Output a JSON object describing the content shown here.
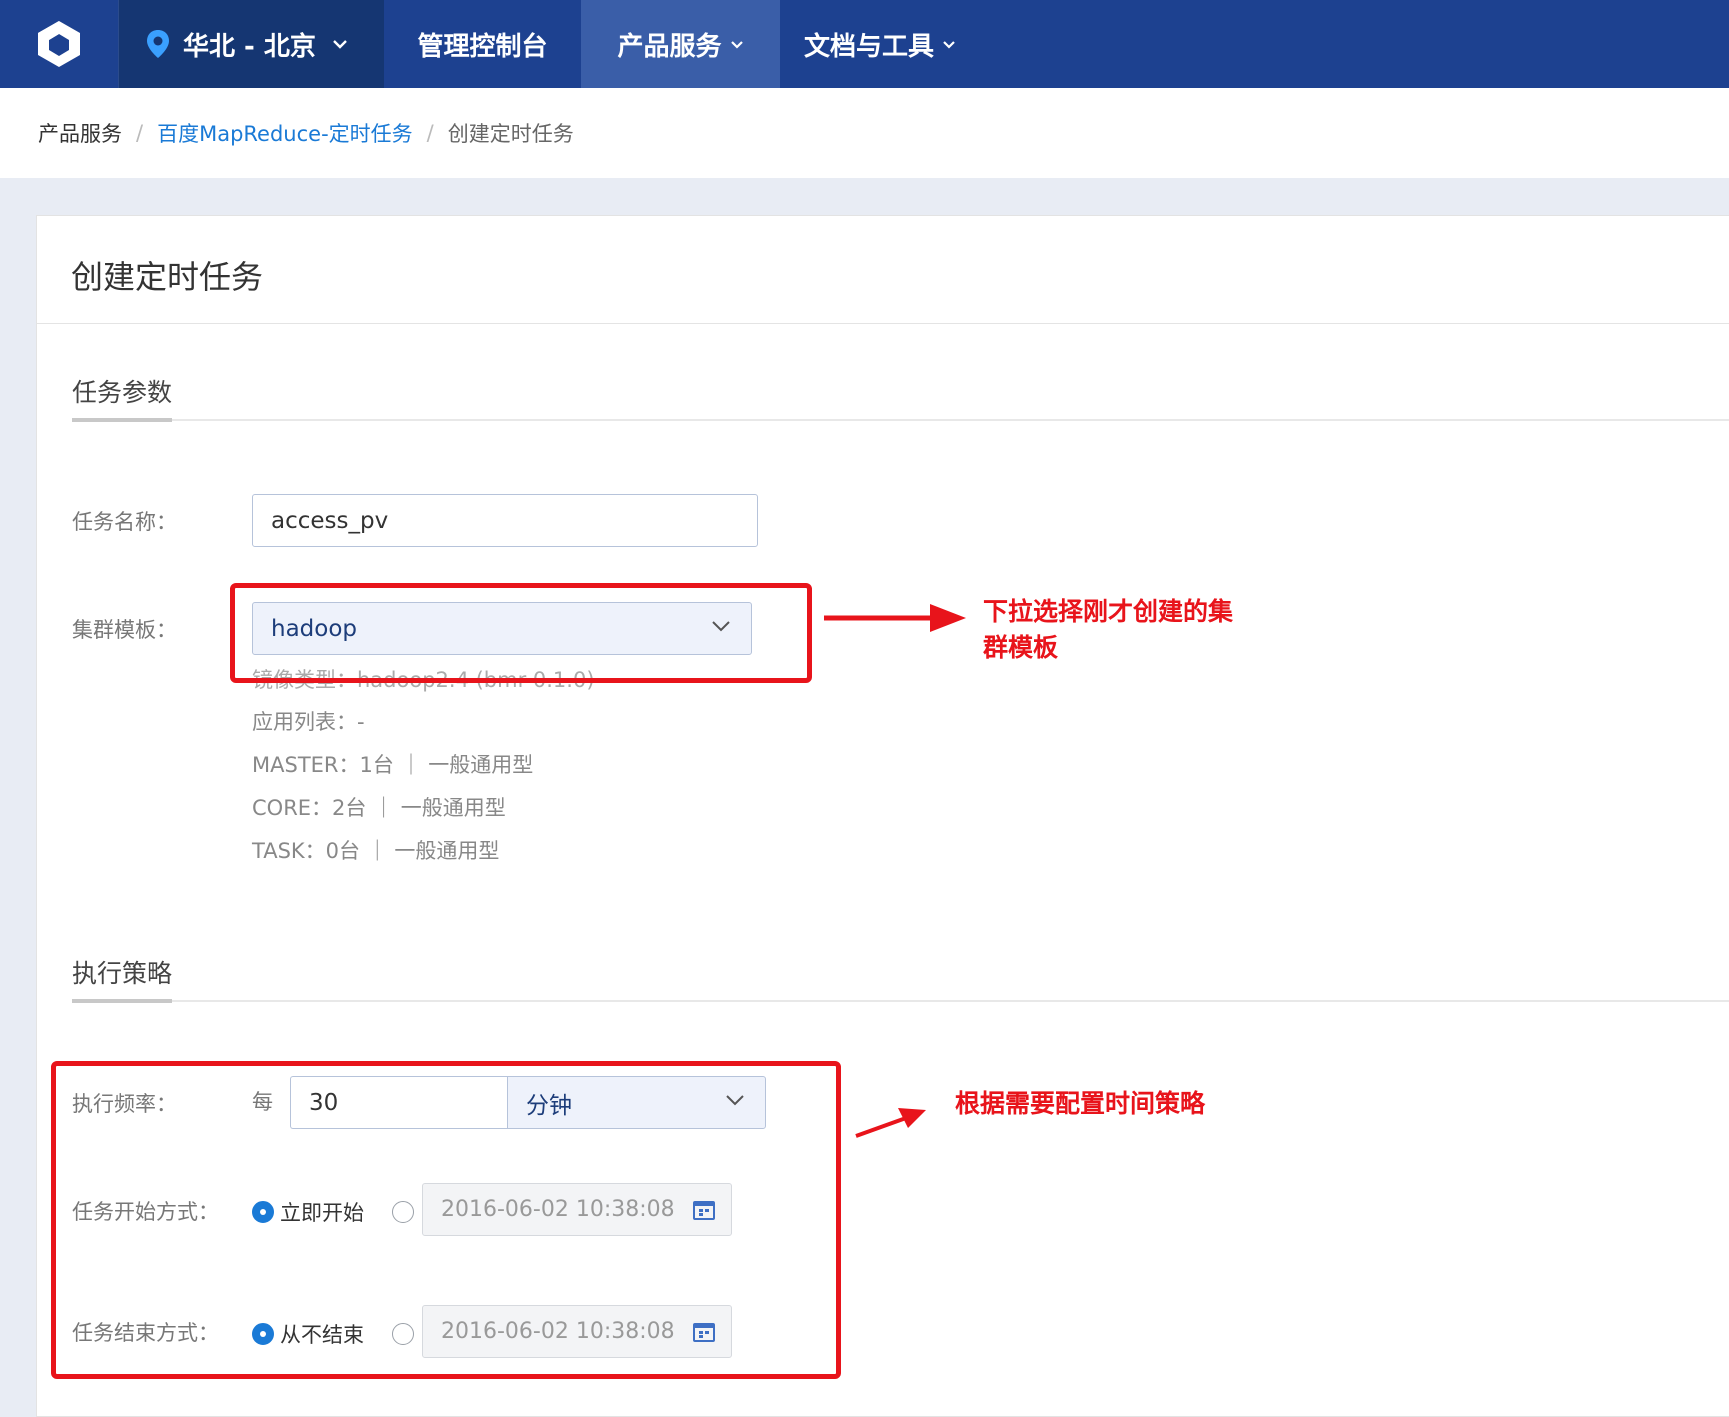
{
  "nav": {
    "region": "华北 - 北京",
    "items": [
      {
        "label": "管理控制台"
      },
      {
        "label": "产品服务"
      },
      {
        "label": "文档与工具"
      }
    ]
  },
  "breadcrumb": {
    "items": [
      "产品服务",
      "百度MapReduce-定时任务",
      "创建定时任务"
    ]
  },
  "page": {
    "title": "创建定时任务",
    "section_params": "任务参数",
    "section_strategy": "执行策略"
  },
  "form": {
    "task_name_label": "任务名称：",
    "task_name_value": "access_pv",
    "cluster_label": "集群模板：",
    "cluster_value": "hadoop",
    "cluster_info": [
      "镜像类型：hadoop2.4 (bmr 0.1.0)",
      "应用列表：-",
      "MASTER：1台 ｜ 一般通用型",
      "CORE：2台 ｜ 一般通用型",
      "TASK：0台 ｜ 一般通用型"
    ],
    "freq_label": "执行频率：",
    "freq_prefix": "每",
    "freq_value": "30",
    "freq_unit": "分钟",
    "start_label": "任务开始方式：",
    "start_option": "立即开始",
    "start_date": "2016-06-02 10:38:08",
    "end_label": "任务结束方式：",
    "end_option": "从不结束",
    "end_date": "2016-06-02 10:38:08"
  },
  "annotations": {
    "cluster_note_line1": "下拉选择刚才创建的集",
    "cluster_note_line2": "群模板",
    "strategy_note": "根据需要配置时间策略"
  },
  "colors": {
    "nav_bg": "#1d4190",
    "nav_active": "#3a5ea8",
    "link": "#1a7ad6",
    "annotation_red": "#e8141b"
  }
}
